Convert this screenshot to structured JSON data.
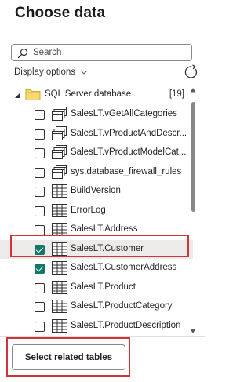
{
  "title": "Choose data",
  "search": {
    "placeholder": "Search",
    "value": ""
  },
  "display_options": {
    "label": "Display options"
  },
  "database": {
    "label": "SQL Server database",
    "count": "[19]"
  },
  "items": [
    {
      "label": "SalesLT.vGetAllCategories",
      "type": "view",
      "checked": false
    },
    {
      "label": "SalesLT.vProductAndDescr...",
      "type": "view",
      "checked": false
    },
    {
      "label": "SalesLT.vProductModelCat...",
      "type": "view",
      "checked": false
    },
    {
      "label": "sys.database_firewall_rules",
      "type": "view",
      "checked": false
    },
    {
      "label": "BuildVersion",
      "type": "table",
      "checked": false
    },
    {
      "label": "ErrorLog",
      "type": "table",
      "checked": false
    },
    {
      "label": "SalesLT.Address",
      "type": "table",
      "checked": false
    },
    {
      "label": "SalesLT.Customer",
      "type": "table",
      "checked": true,
      "selected": true
    },
    {
      "label": "SalesLT.CustomerAddress",
      "type": "table",
      "checked": true
    },
    {
      "label": "SalesLT.Product",
      "type": "table",
      "checked": false
    },
    {
      "label": "SalesLT.ProductCategory",
      "type": "table",
      "checked": false
    },
    {
      "label": "SalesLT.ProductDescription",
      "type": "table",
      "checked": false
    }
  ],
  "select_related_button": {
    "label": "Select related tables"
  },
  "colors": {
    "checkbox_checked": "#117865",
    "highlight": "#d13438",
    "selected_row": "#edebe9"
  }
}
